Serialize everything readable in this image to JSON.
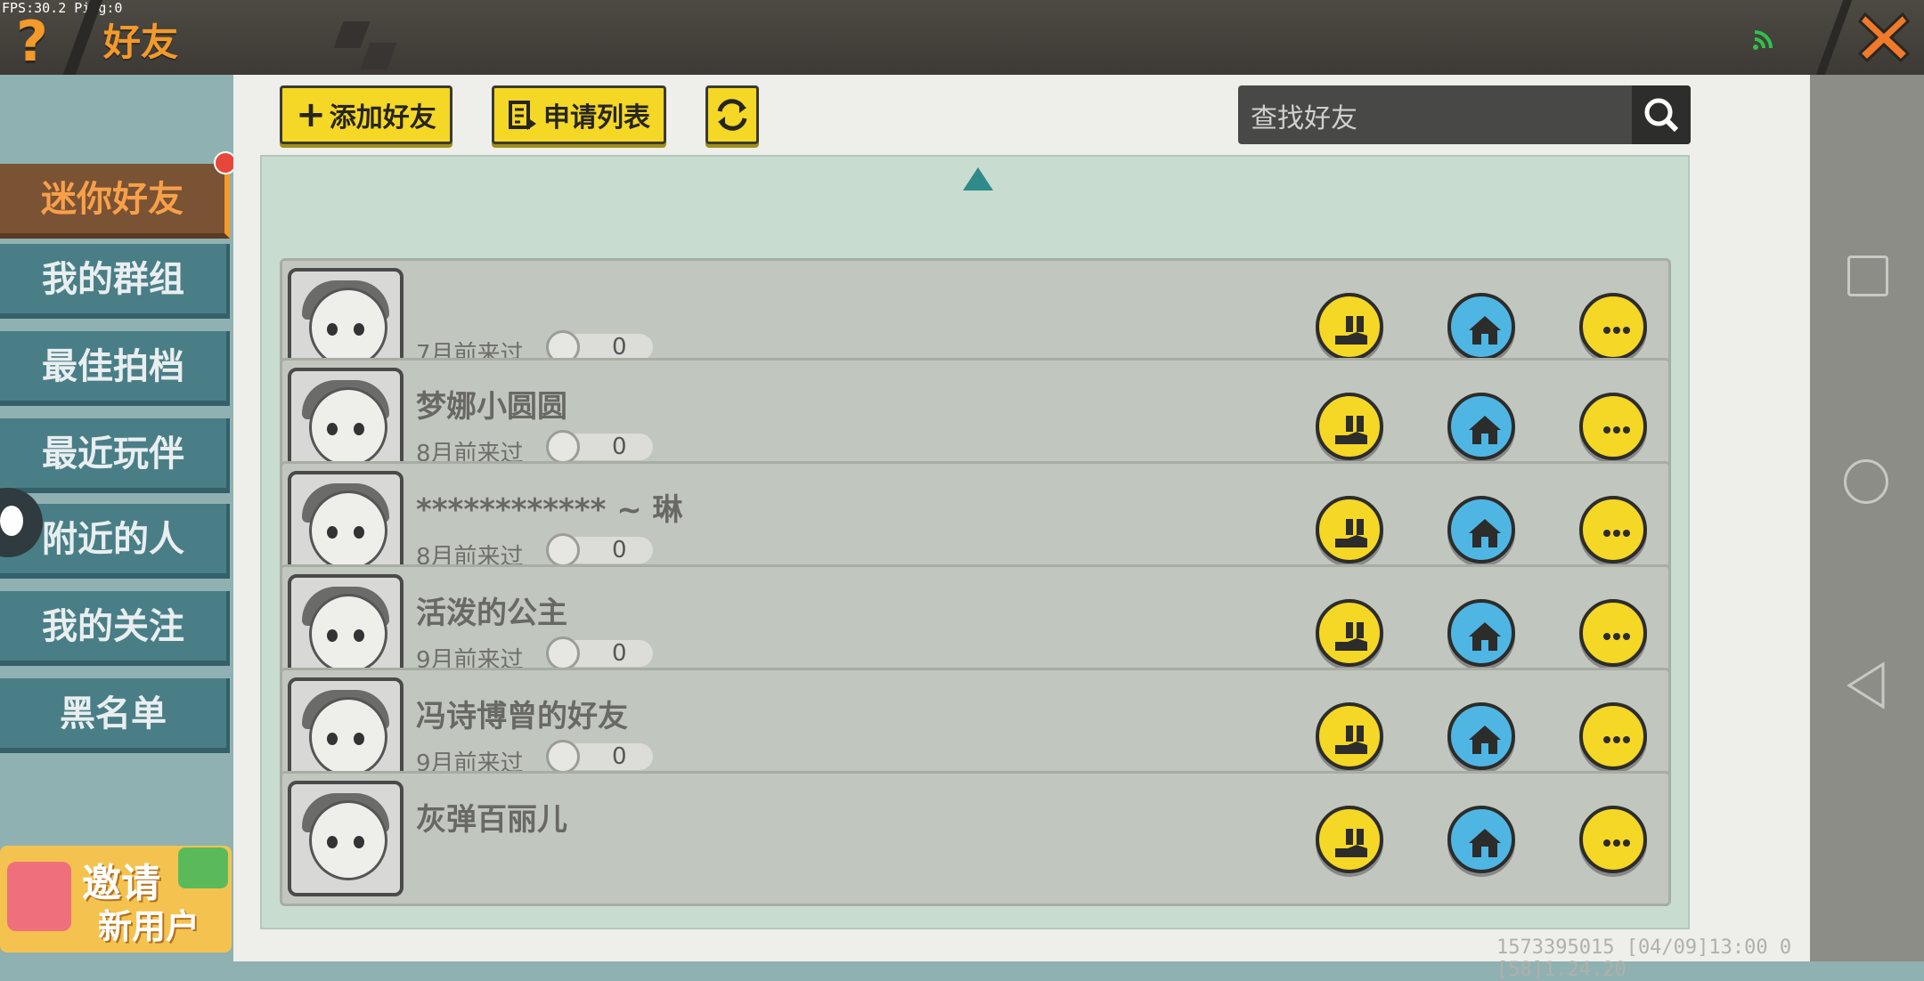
{
  "status": {
    "fps": "FPS:30.2  Ping:0"
  },
  "header": {
    "title": "好友",
    "help": "?"
  },
  "sidebar": {
    "items": [
      {
        "label": "迷你好友"
      },
      {
        "label": "我的群组"
      },
      {
        "label": "最佳拍档"
      },
      {
        "label": "最近玩伴"
      },
      {
        "label": "附近的人"
      },
      {
        "label": "我的关注"
      },
      {
        "label": "黑名单"
      }
    ],
    "invite": {
      "line1": "邀请",
      "line2": "新用户"
    }
  },
  "toolbar": {
    "add_friend": "添加好友",
    "request_list": "申请列表",
    "search_placeholder": "查找好友"
  },
  "friends": [
    {
      "name": "",
      "seen": "7月前来过",
      "score": "0"
    },
    {
      "name": "梦娜小圆圆",
      "seen": "8月前来过",
      "score": "0"
    },
    {
      "name": "************ ~ 琳",
      "seen": "8月前来过",
      "score": "0"
    },
    {
      "name": "活泼的公主",
      "seen": "9月前来过",
      "score": "0"
    },
    {
      "name": "冯诗博曾的好友",
      "seen": "9月前来过",
      "score": "0"
    },
    {
      "name": "灰弹百丽儿",
      "seen": "",
      "score": ""
    }
  ],
  "footer": {
    "text": "1573395015  [04/09]13:00 0  [58]1.24.20"
  }
}
